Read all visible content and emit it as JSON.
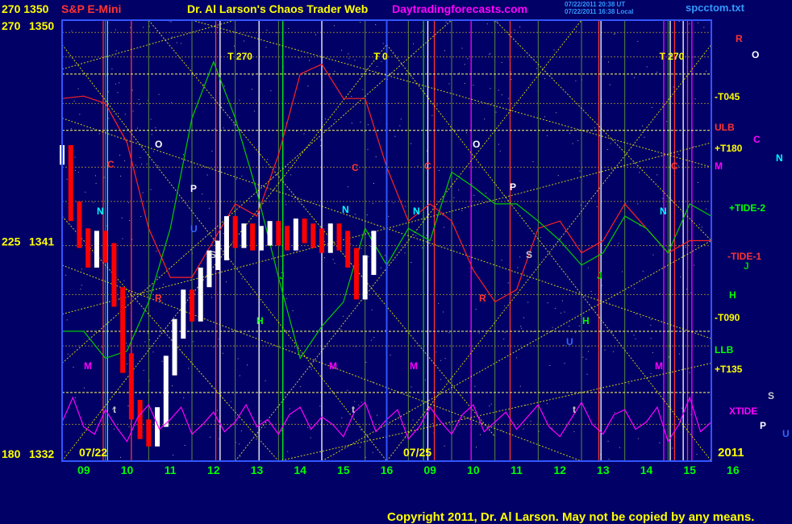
{
  "header": {
    "instrument_prefix": "270  1350",
    "instrument": "S&P E-Mini",
    "title": "Dr. Al Larson's Chaos Trader Web",
    "site": "Daytradingforecasts.com",
    "stamp_line1": "07/22/2011 20:38 UT",
    "stamp_line2": "07/22/2011 16:38 Local",
    "filename": "spcctom.txt"
  },
  "footer": {
    "copyright": "Copyright 2011, Dr. Al Larson. May not be copied by any means.",
    "year": "2011",
    "date_left": "07/22",
    "date_right": "07/25"
  },
  "y_axis_labels": [
    {
      "angle": "270",
      "price": "1350"
    },
    {
      "angle": "225",
      "price": "1341"
    },
    {
      "angle": "180",
      "price": "1332"
    }
  ],
  "x_axis_labels": [
    "09",
    "10",
    "11",
    "12",
    "13",
    "14",
    "15",
    "16",
    "09",
    "10",
    "11",
    "12",
    "13",
    "14",
    "15",
    "16"
  ],
  "time_markers": [
    {
      "label": "T  270",
      "pos": 0.255
    },
    {
      "label": "T  0",
      "pos": 0.48
    },
    {
      "label": "T  270",
      "pos": 0.92
    }
  ],
  "right_labels": [
    {
      "text": "R",
      "color": "#ff3333"
    },
    {
      "text": "O",
      "color": "#ffffff"
    },
    {
      "text": "-T045",
      "color": "#ffff00"
    },
    {
      "text": "ULB",
      "color": "#ff3333"
    },
    {
      "text": "C",
      "color": "#ff00ff"
    },
    {
      "text": "+T180",
      "color": "#ffff00"
    },
    {
      "text": "N",
      "color": "#00ffff"
    },
    {
      "text": "M",
      "color": "#ff00ff"
    },
    {
      "text": "+TIDE-2",
      "color": "#00ff00"
    },
    {
      "text": "-TIDE-1",
      "color": "#ff3333"
    },
    {
      "text": "J",
      "color": "#00cc00"
    },
    {
      "text": "H",
      "color": "#00ff00"
    },
    {
      "text": "-T090",
      "color": "#ffff00"
    },
    {
      "text": "LLB",
      "color": "#00ff00"
    },
    {
      "text": "+T135",
      "color": "#ffff00"
    },
    {
      "text": "S",
      "color": "#cccccc"
    },
    {
      "text": "XTIDE",
      "color": "#ff00ff"
    },
    {
      "text": "P",
      "color": "#ffffff"
    },
    {
      "text": "U",
      "color": "#3366ff"
    }
  ],
  "planet_letters": [
    {
      "text": "C",
      "color": "#ff3333"
    },
    {
      "text": "O",
      "color": "#ffffff"
    },
    {
      "text": "P",
      "color": "#ffffff"
    },
    {
      "text": "N",
      "color": "#00ffff"
    },
    {
      "text": "S",
      "color": "#cccccc"
    },
    {
      "text": "R",
      "color": "#ff3333"
    },
    {
      "text": "J",
      "color": "#00cc00"
    },
    {
      "text": "H",
      "color": "#00ff00"
    },
    {
      "text": "M",
      "color": "#ff00ff"
    },
    {
      "text": "U",
      "color": "#3366ff"
    },
    {
      "text": "t",
      "color": "#cccccc"
    }
  ],
  "colors": {
    "background": "#000066",
    "axis": "#3355ff",
    "price_up": "#ffffff",
    "price_down": "#ff0000",
    "lower_band": "#00cc00",
    "upper_band": "#ff2222",
    "xtide": "#ff00ff",
    "t_lines": "#ffff00",
    "time_markers": "#ffff00",
    "title": "#ffff00",
    "instrument": "#ff3333",
    "site": "#ff00ff",
    "stamp": "#3399ff",
    "x_labels": "#00ff00",
    "copyright": "#ffff00"
  },
  "chart_data": {
    "type": "line",
    "title": "S&P E-Mini",
    "ylim": [
      1332,
      1350
    ],
    "y_ticks": [
      1332,
      1341,
      1350
    ],
    "x_sessions": [
      "07/22",
      "07/25"
    ],
    "x_hours": [
      "09",
      "10",
      "11",
      "12",
      "13",
      "14",
      "15",
      "16",
      "09",
      "10",
      "11",
      "12",
      "13",
      "14",
      "15",
      "16"
    ],
    "series": [
      {
        "name": "S&P E-Mini",
        "style": "bars",
        "x": [
          0.0,
          0.2,
          0.4,
          0.6,
          0.8,
          1.0,
          1.2,
          1.4,
          1.6,
          1.8,
          2.0,
          2.2,
          2.4,
          2.6,
          2.8,
          3.0,
          3.2,
          3.4,
          3.6,
          3.8,
          4.0,
          4.2,
          4.4,
          4.6,
          4.8,
          5.0,
          5.2,
          5.4,
          5.6,
          5.8,
          6.0,
          6.2,
          6.4,
          6.6,
          6.8,
          7.0,
          7.2
        ],
        "values": [
          1344.5,
          1342.2,
          1341.1,
          1340.3,
          1341.0,
          1340.5,
          1338.7,
          1336.0,
          1334.1,
          1333.3,
          1333.0,
          1333.8,
          1335.9,
          1337.4,
          1338.6,
          1338.1,
          1339.5,
          1340.2,
          1340.6,
          1341.6,
          1341.1,
          1341.3,
          1341.0,
          1341.2,
          1341.4,
          1341.2,
          1341.0,
          1341.5,
          1341.3,
          1341.1,
          1340.9,
          1341.3,
          1341.0,
          1340.3,
          1339.0,
          1340.0,
          1341.0
        ]
      },
      {
        "name": "-TIDE-1",
        "x": [
          0,
          0.5,
          1,
          1.5,
          2,
          2.5,
          3,
          3.5,
          4,
          4.5,
          5,
          5.5,
          6,
          6.5,
          7,
          7.5,
          8,
          8.5,
          9,
          9.5,
          10,
          10.5,
          11,
          11.5,
          12,
          12.5,
          13,
          13.5,
          14,
          14.5,
          15
        ],
        "values": [
          1346.8,
          1346.9,
          1346.6,
          1345,
          1341.5,
          1339.5,
          1339.5,
          1341,
          1342.5,
          1342,
          1344.5,
          1347.8,
          1348.2,
          1346.8,
          1346.8,
          1344,
          1341.8,
          1342.5,
          1341.8,
          1339.8,
          1338.5,
          1339,
          1341.5,
          1341.8,
          1340.5,
          1341,
          1342.5,
          1341.5,
          1340.5,
          1341,
          1341
        ]
      },
      {
        "name": "+TIDE-2",
        "x": [
          0,
          0.5,
          1,
          1.5,
          2,
          2.5,
          3,
          3.5,
          4,
          4.5,
          5,
          5.5,
          6,
          6.5,
          7,
          7.5,
          8,
          8.5,
          9,
          9.5,
          10,
          10.5,
          11,
          11.5,
          12,
          12.5,
          13,
          13.5,
          14,
          14.5,
          15
        ],
        "values": [
          1337.3,
          1337.3,
          1336.2,
          1336.5,
          1338.5,
          1341.5,
          1346,
          1348.3,
          1346,
          1343,
          1339.5,
          1336.2,
          1337.5,
          1338.5,
          1341.5,
          1340,
          1341.5,
          1341,
          1343.8,
          1343.2,
          1342.5,
          1342.5,
          1341.8,
          1341,
          1340,
          1340.5,
          1342,
          1341.5,
          1340.5,
          1342.5,
          1342
        ]
      },
      {
        "name": "XTIDE",
        "style": "oscillator",
        "x": [
          0,
          0.25,
          0.5,
          0.75,
          1,
          1.25,
          1.5,
          1.75,
          2,
          2.25,
          2.5,
          2.75,
          3,
          3.25,
          3.5,
          3.75,
          4,
          4.25,
          4.5,
          4.75,
          5,
          5.25,
          5.5,
          5.75,
          6,
          6.25,
          6.5,
          6.75,
          7,
          7.25,
          7.5,
          7.75,
          8,
          8.25,
          8.5,
          8.75,
          9,
          9.25,
          9.5,
          9.75,
          10,
          10.25,
          10.5,
          10.75,
          11,
          11.25,
          11.5,
          11.75,
          12,
          12.25,
          12.5,
          12.75,
          13,
          13.25,
          13.5,
          13.75,
          14,
          14.25,
          14.5,
          14.75,
          15
        ],
        "values": [
          1333.6,
          1334.6,
          1333.4,
          1333.1,
          1334.1,
          1333.4,
          1332.8,
          1333.8,
          1334.3,
          1333.3,
          1333.7,
          1334.2,
          1333.1,
          1333.5,
          1334.0,
          1333.2,
          1333.6,
          1334.3,
          1333.4,
          1333.7,
          1333.1,
          1333.9,
          1334.2,
          1333.3,
          1333.8,
          1333.5,
          1333.0,
          1334.0,
          1334.4,
          1333.2,
          1333.7,
          1334.1,
          1332.9,
          1333.4,
          1334.2,
          1333.6,
          1333.1,
          1333.9,
          1334.3,
          1333.2,
          1333.6,
          1334.0,
          1333.3,
          1333.8,
          1334.3,
          1333.4,
          1333.0,
          1333.7,
          1334.4,
          1333.5,
          1333.1,
          1333.9,
          1334.1,
          1333.3,
          1333.6,
          1334.2,
          1332.8,
          1333.5,
          1334.6,
          1333.2,
          1333.6
        ]
      }
    ],
    "horizontal_lines": [
      {
        "name": "-T045",
        "value": 1347.8
      },
      {
        "name": "+T180",
        "value": 1345.5
      },
      {
        "name": "-T090",
        "value": 1337.3
      },
      {
        "name": "+T135",
        "value": 1334.8
      }
    ],
    "grid": true
  }
}
